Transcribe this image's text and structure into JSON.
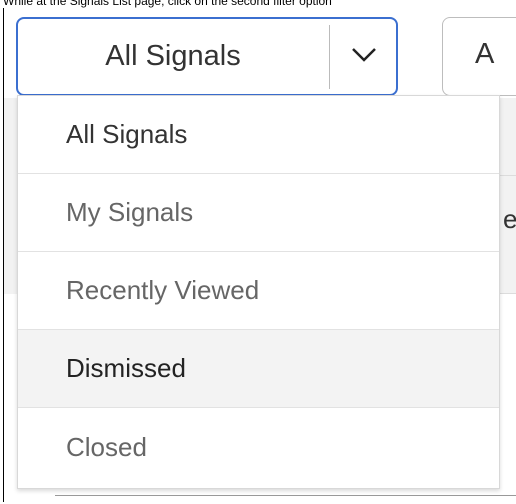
{
  "caption": "While at the Signals List page, click on the second filter option",
  "filter": {
    "selected": "All Signals",
    "second_label_partial": "A",
    "options": [
      {
        "label": "All Signals"
      },
      {
        "label": "My Signals"
      },
      {
        "label": "Recently Viewed"
      },
      {
        "label": "Dismissed"
      },
      {
        "label": "Closed"
      }
    ]
  },
  "background": {
    "partial_text": "e"
  },
  "colors": {
    "focus_border": "#3b6fd0",
    "highlight_row": "#f3f3f3"
  }
}
